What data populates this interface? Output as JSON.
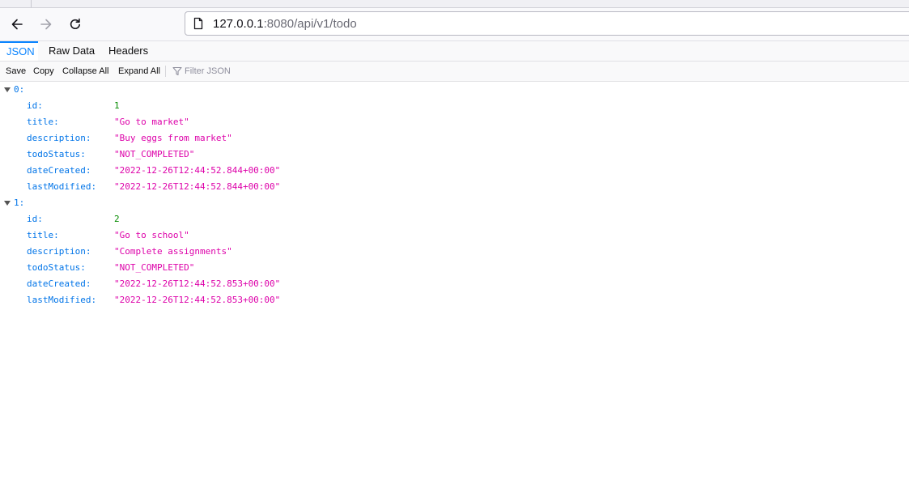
{
  "browser": {
    "url_host": "127.0.0.1",
    "url_path": ":8080/api/v1/todo"
  },
  "viewer_tabs": [
    "JSON",
    "Raw Data",
    "Headers"
  ],
  "toolbar": {
    "save": "Save",
    "copy": "Copy",
    "collapse_all": "Collapse All",
    "expand_all": "Expand All",
    "filter_placeholder": "Filter JSON"
  },
  "json": {
    "items": [
      {
        "index_label": "0:",
        "fields": [
          {
            "key": "id:",
            "value": "1",
            "type": "num"
          },
          {
            "key": "title:",
            "value": "\"Go to market\"",
            "type": "str"
          },
          {
            "key": "description:",
            "value": "\"Buy eggs from market\"",
            "type": "str"
          },
          {
            "key": "todoStatus:",
            "value": "\"NOT_COMPLETED\"",
            "type": "str"
          },
          {
            "key": "dateCreated:",
            "value": "\"2022-12-26T12:44:52.844+00:00\"",
            "type": "str"
          },
          {
            "key": "lastModified:",
            "value": "\"2022-12-26T12:44:52.844+00:00\"",
            "type": "str"
          }
        ]
      },
      {
        "index_label": "1:",
        "fields": [
          {
            "key": "id:",
            "value": "2",
            "type": "num"
          },
          {
            "key": "title:",
            "value": "\"Go to school\"",
            "type": "str"
          },
          {
            "key": "description:",
            "value": "\"Complete assignments\"",
            "type": "str"
          },
          {
            "key": "todoStatus:",
            "value": "\"NOT_COMPLETED\"",
            "type": "str"
          },
          {
            "key": "dateCreated:",
            "value": "\"2022-12-26T12:44:52.853+00:00\"",
            "type": "str"
          },
          {
            "key": "lastModified:",
            "value": "\"2022-12-26T12:44:52.853+00:00\"",
            "type": "str"
          }
        ]
      }
    ]
  },
  "colors": {
    "accent": "#0a84ff",
    "json_key": "#0074e8",
    "json_number": "#058b00",
    "json_string": "#dd00a9"
  }
}
